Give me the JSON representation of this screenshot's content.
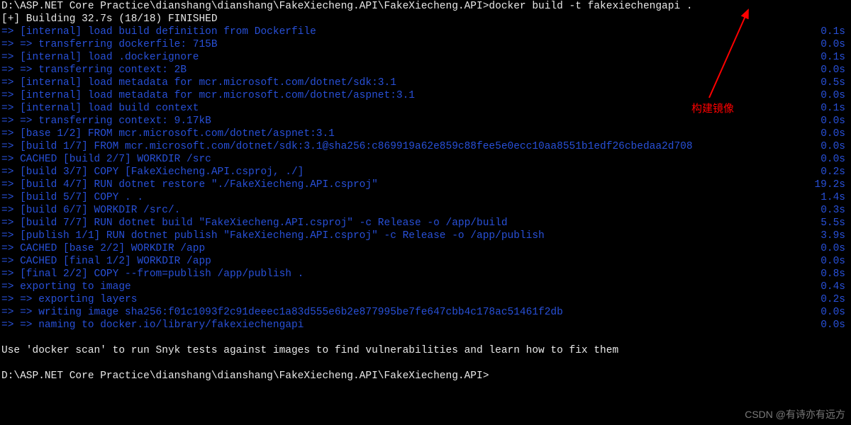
{
  "prompt1": {
    "path": "D:\\ASP.NET Core Practice\\dianshang\\dianshang\\FakeXiecheng.API\\FakeXiecheng.API>",
    "cmd": "docker build -t fakexiechengapi ."
  },
  "buildHeader": "[+] Building 32.7s (18/18) FINISHED",
  "steps": [
    {
      "a": "=>",
      "txt": " [internal] load build definition from Dockerfile",
      "t": "0.1s"
    },
    {
      "a": "=>",
      "txt": " => transferring dockerfile: 715B",
      "t": "0.0s"
    },
    {
      "a": "=>",
      "txt": " [internal] load .dockerignore",
      "t": "0.1s"
    },
    {
      "a": "=>",
      "txt": " => transferring context: 2B",
      "t": "0.0s"
    },
    {
      "a": "=>",
      "txt": " [internal] load metadata for mcr.microsoft.com/dotnet/sdk:3.1",
      "t": "0.5s"
    },
    {
      "a": "=>",
      "txt": " [internal] load metadata for mcr.microsoft.com/dotnet/aspnet:3.1",
      "t": "0.0s"
    },
    {
      "a": "=>",
      "txt": " [internal] load build context",
      "t": "0.1s"
    },
    {
      "a": "=>",
      "txt": " => transferring context: 9.17kB",
      "t": "0.0s"
    },
    {
      "a": "=>",
      "txt": " [base 1/2] FROM mcr.microsoft.com/dotnet/aspnet:3.1",
      "t": "0.0s"
    },
    {
      "a": "=>",
      "txt": " [build 1/7] FROM mcr.microsoft.com/dotnet/sdk:3.1@sha256:c869919a62e859c88fee5e0ecc10aa8551b1edf26cbedaa2d708",
      "t": "0.0s"
    },
    {
      "a": "=>",
      "txt": " CACHED [build 2/7] WORKDIR /src",
      "t": "0.0s"
    },
    {
      "a": "=>",
      "txt": " [build 3/7] COPY [FakeXiecheng.API.csproj, ./]",
      "t": "0.2s"
    },
    {
      "a": "=>",
      "txt": " [build 4/7] RUN dotnet restore \"./FakeXiecheng.API.csproj\"",
      "t": "19.2s"
    },
    {
      "a": "=>",
      "txt": " [build 5/7] COPY . .",
      "t": "1.4s"
    },
    {
      "a": "=>",
      "txt": " [build 6/7] WORKDIR /src/.",
      "t": "0.3s"
    },
    {
      "a": "=>",
      "txt": " [build 7/7] RUN dotnet build \"FakeXiecheng.API.csproj\" -c Release -o /app/build",
      "t": "5.5s"
    },
    {
      "a": "=>",
      "txt": " [publish 1/1] RUN dotnet publish \"FakeXiecheng.API.csproj\" -c Release -o /app/publish",
      "t": "3.9s"
    },
    {
      "a": "=>",
      "txt": " CACHED [base 2/2] WORKDIR /app",
      "t": "0.0s"
    },
    {
      "a": "=>",
      "txt": " CACHED [final 1/2] WORKDIR /app",
      "t": "0.0s"
    },
    {
      "a": "=>",
      "txt": " [final 2/2] COPY --from=publish /app/publish .",
      "t": "0.8s"
    },
    {
      "a": "=>",
      "txt": " exporting to image",
      "t": "0.4s"
    },
    {
      "a": "=>",
      "txt": " => exporting layers",
      "t": "0.2s"
    },
    {
      "a": "=>",
      "txt": " => writing image sha256:f01c1093f2c91deeec1a83d555e6b2e877995be7fe647cbb4c178ac51461f2db",
      "t": "0.0s"
    },
    {
      "a": "=>",
      "txt": " => naming to docker.io/library/fakexiechengapi",
      "t": "0.0s"
    }
  ],
  "scanHint": "Use 'docker scan' to run Snyk tests against images to find vulnerabilities and learn how to fix them",
  "prompt2": "D:\\ASP.NET Core Practice\\dianshang\\dianshang\\FakeXiecheng.API\\FakeXiecheng.API>",
  "annotation": "构建镜像",
  "watermark": "CSDN @有诗亦有远方"
}
